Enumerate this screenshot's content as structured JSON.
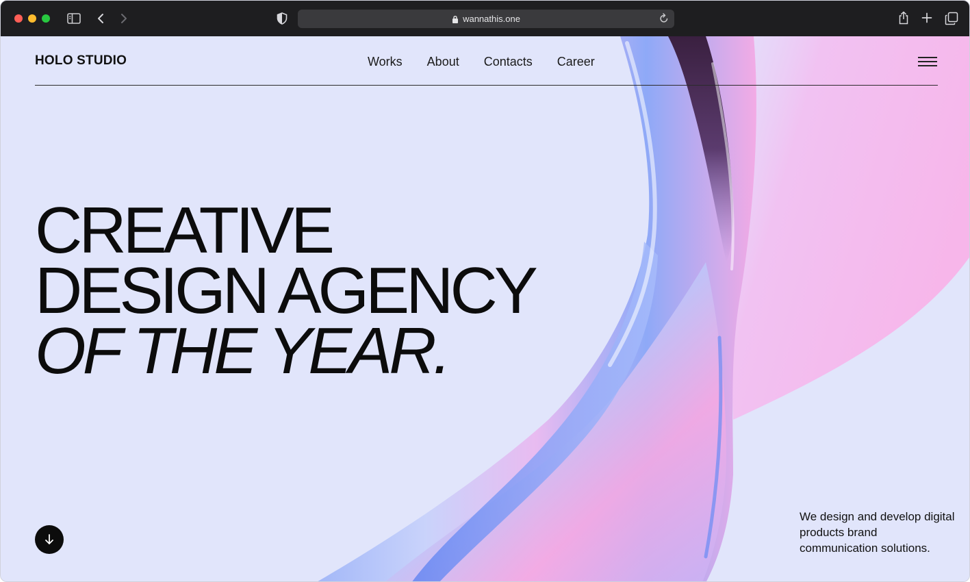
{
  "browser": {
    "url": "wannathis.one",
    "icons": {
      "sidebar": "sidebar-icon",
      "back": "chevron-left-icon",
      "forward": "chevron-right-icon",
      "privacy": "shield-icon",
      "lock": "lock-icon",
      "reload": "reload-icon",
      "share": "share-icon",
      "new_tab": "plus-icon",
      "tabs": "tabs-overview-icon"
    }
  },
  "site": {
    "logo": "HOLO STUDIO",
    "nav": [
      "Works",
      "About",
      "Contacts",
      "Career"
    ],
    "headline": {
      "line1": "CREATIVE",
      "line2": "DESIGN AGENCY",
      "line3": "OF THE YEAR."
    },
    "tagline": "We design and develop digital products brand communication solutions.",
    "scroll_icon": "arrow-down-icon",
    "menu_icon": "hamburger-menu-icon"
  },
  "colors": {
    "chrome": "#1e1e20",
    "page_bg": "#e1e5fb",
    "accent_pink": "#f2a6e6",
    "accent_blue": "#7f9cf5",
    "text": "#0c0c0c"
  }
}
